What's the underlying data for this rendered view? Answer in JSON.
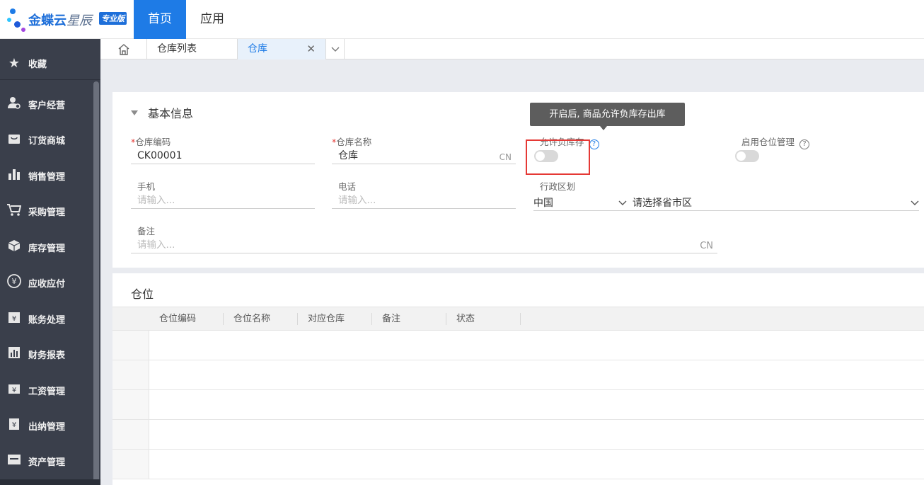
{
  "app": {
    "logo_main": "金蝶云",
    "logo_sub": "星辰",
    "logo_badge": "专业版",
    "nav": {
      "home": "首页",
      "apps": "应用"
    }
  },
  "sidebar": {
    "items": [
      {
        "label": "收藏",
        "icon": "star-icon"
      },
      {
        "label": "客户经营",
        "icon": "user-gear-icon"
      },
      {
        "label": "订货商城",
        "icon": "shop-bag-icon"
      },
      {
        "label": "销售管理",
        "icon": "bar-chart-icon"
      },
      {
        "label": "采购管理",
        "icon": "cart-icon"
      },
      {
        "label": "库存管理",
        "icon": "box-icon"
      },
      {
        "label": "应收应付",
        "icon": "coin-icon"
      },
      {
        "label": "账务处理",
        "icon": "ledger-icon"
      },
      {
        "label": "财务报表",
        "icon": "report-icon"
      },
      {
        "label": "工资管理",
        "icon": "salary-icon"
      },
      {
        "label": "出纳管理",
        "icon": "cashier-icon"
      },
      {
        "label": "资产管理",
        "icon": "asset-icon"
      }
    ]
  },
  "tabs": {
    "list": "仓库列表",
    "active": "仓库"
  },
  "basic": {
    "title": "基本信息",
    "code": {
      "label": "仓库编码",
      "value": "CK00001"
    },
    "name": {
      "label": "仓库名称",
      "value": "仓库",
      "suffix": "CN"
    },
    "allow_negative": {
      "label": "允许负库存"
    },
    "enable_location": {
      "label": "启用仓位管理"
    },
    "phone": {
      "label": "手机",
      "placeholder": "请输入..."
    },
    "tel": {
      "label": "电话",
      "placeholder": "请输入..."
    },
    "region": {
      "label": "行政区划",
      "country": "中国",
      "province_placeholder": "请选择省市区"
    },
    "remark": {
      "label": "备注",
      "placeholder": "请输入...",
      "suffix": "CN"
    },
    "tooltip": "开启后, 商品允许负库存出库",
    "help_mark": "?"
  },
  "locations": {
    "title": "仓位",
    "columns": [
      "仓位编码",
      "仓位名称",
      "对应仓库",
      "备注",
      "状态"
    ]
  },
  "colors": {
    "accent": "#1e7be6",
    "sidebar": "#3a3f4b",
    "highlight": "#e53935"
  }
}
